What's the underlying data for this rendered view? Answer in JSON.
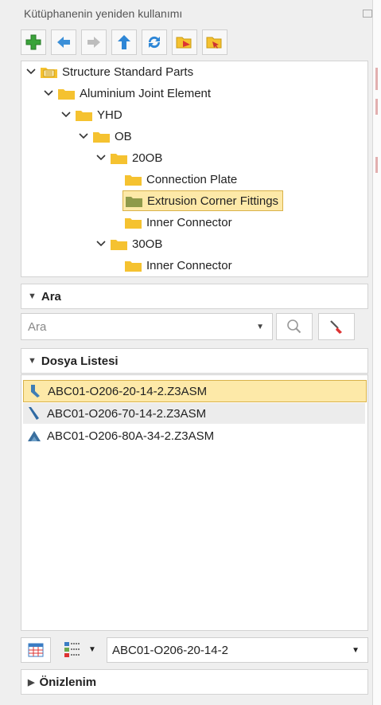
{
  "panel": {
    "title": "Kütüphanenin yeniden kullanımı"
  },
  "toolbar": {
    "icons": [
      "add-icon",
      "back-arrow-icon",
      "forward-arrow-icon",
      "up-arrow-icon",
      "refresh-icon",
      "folder-open-icon",
      "folder-settings-icon"
    ]
  },
  "tree": {
    "items": [
      {
        "label": "Structure Standard Parts",
        "level": 0,
        "expanded": true,
        "icon": "library-folder-icon"
      },
      {
        "label": "Aluminium Joint Element",
        "level": 1,
        "expanded": true
      },
      {
        "label": "YHD",
        "level": 2,
        "expanded": true
      },
      {
        "label": "OB",
        "level": 3,
        "expanded": true
      },
      {
        "label": "20OB",
        "level": 4,
        "expanded": true
      },
      {
        "label": "Connection Plate",
        "level": 5
      },
      {
        "label": "Extrusion Corner Fittings",
        "level": 5,
        "selected": true
      },
      {
        "label": "Inner Connector",
        "level": 5
      },
      {
        "label": "30OB",
        "level": 4,
        "expanded": true
      },
      {
        "label": "Inner Connector",
        "level": 5
      }
    ]
  },
  "search": {
    "header": "Ara",
    "placeholder": "Ara"
  },
  "filelist": {
    "header": "Dosya Listesi",
    "files": [
      {
        "name": "ABC01-O206-20-14-2.Z3ASM",
        "selected": true
      },
      {
        "name": "ABC01-O206-70-14-2.Z3ASM",
        "hover": true
      },
      {
        "name": "ABC01-O206-80A-34-2.Z3ASM"
      }
    ]
  },
  "bottom": {
    "combo_value": "ABC01-O206-20-14-2"
  },
  "preview": {
    "header": "Önizlenim"
  },
  "colors": {
    "selection": "#fde9a8",
    "selection_border": "#d9b24a",
    "folder": "#f5c230"
  }
}
